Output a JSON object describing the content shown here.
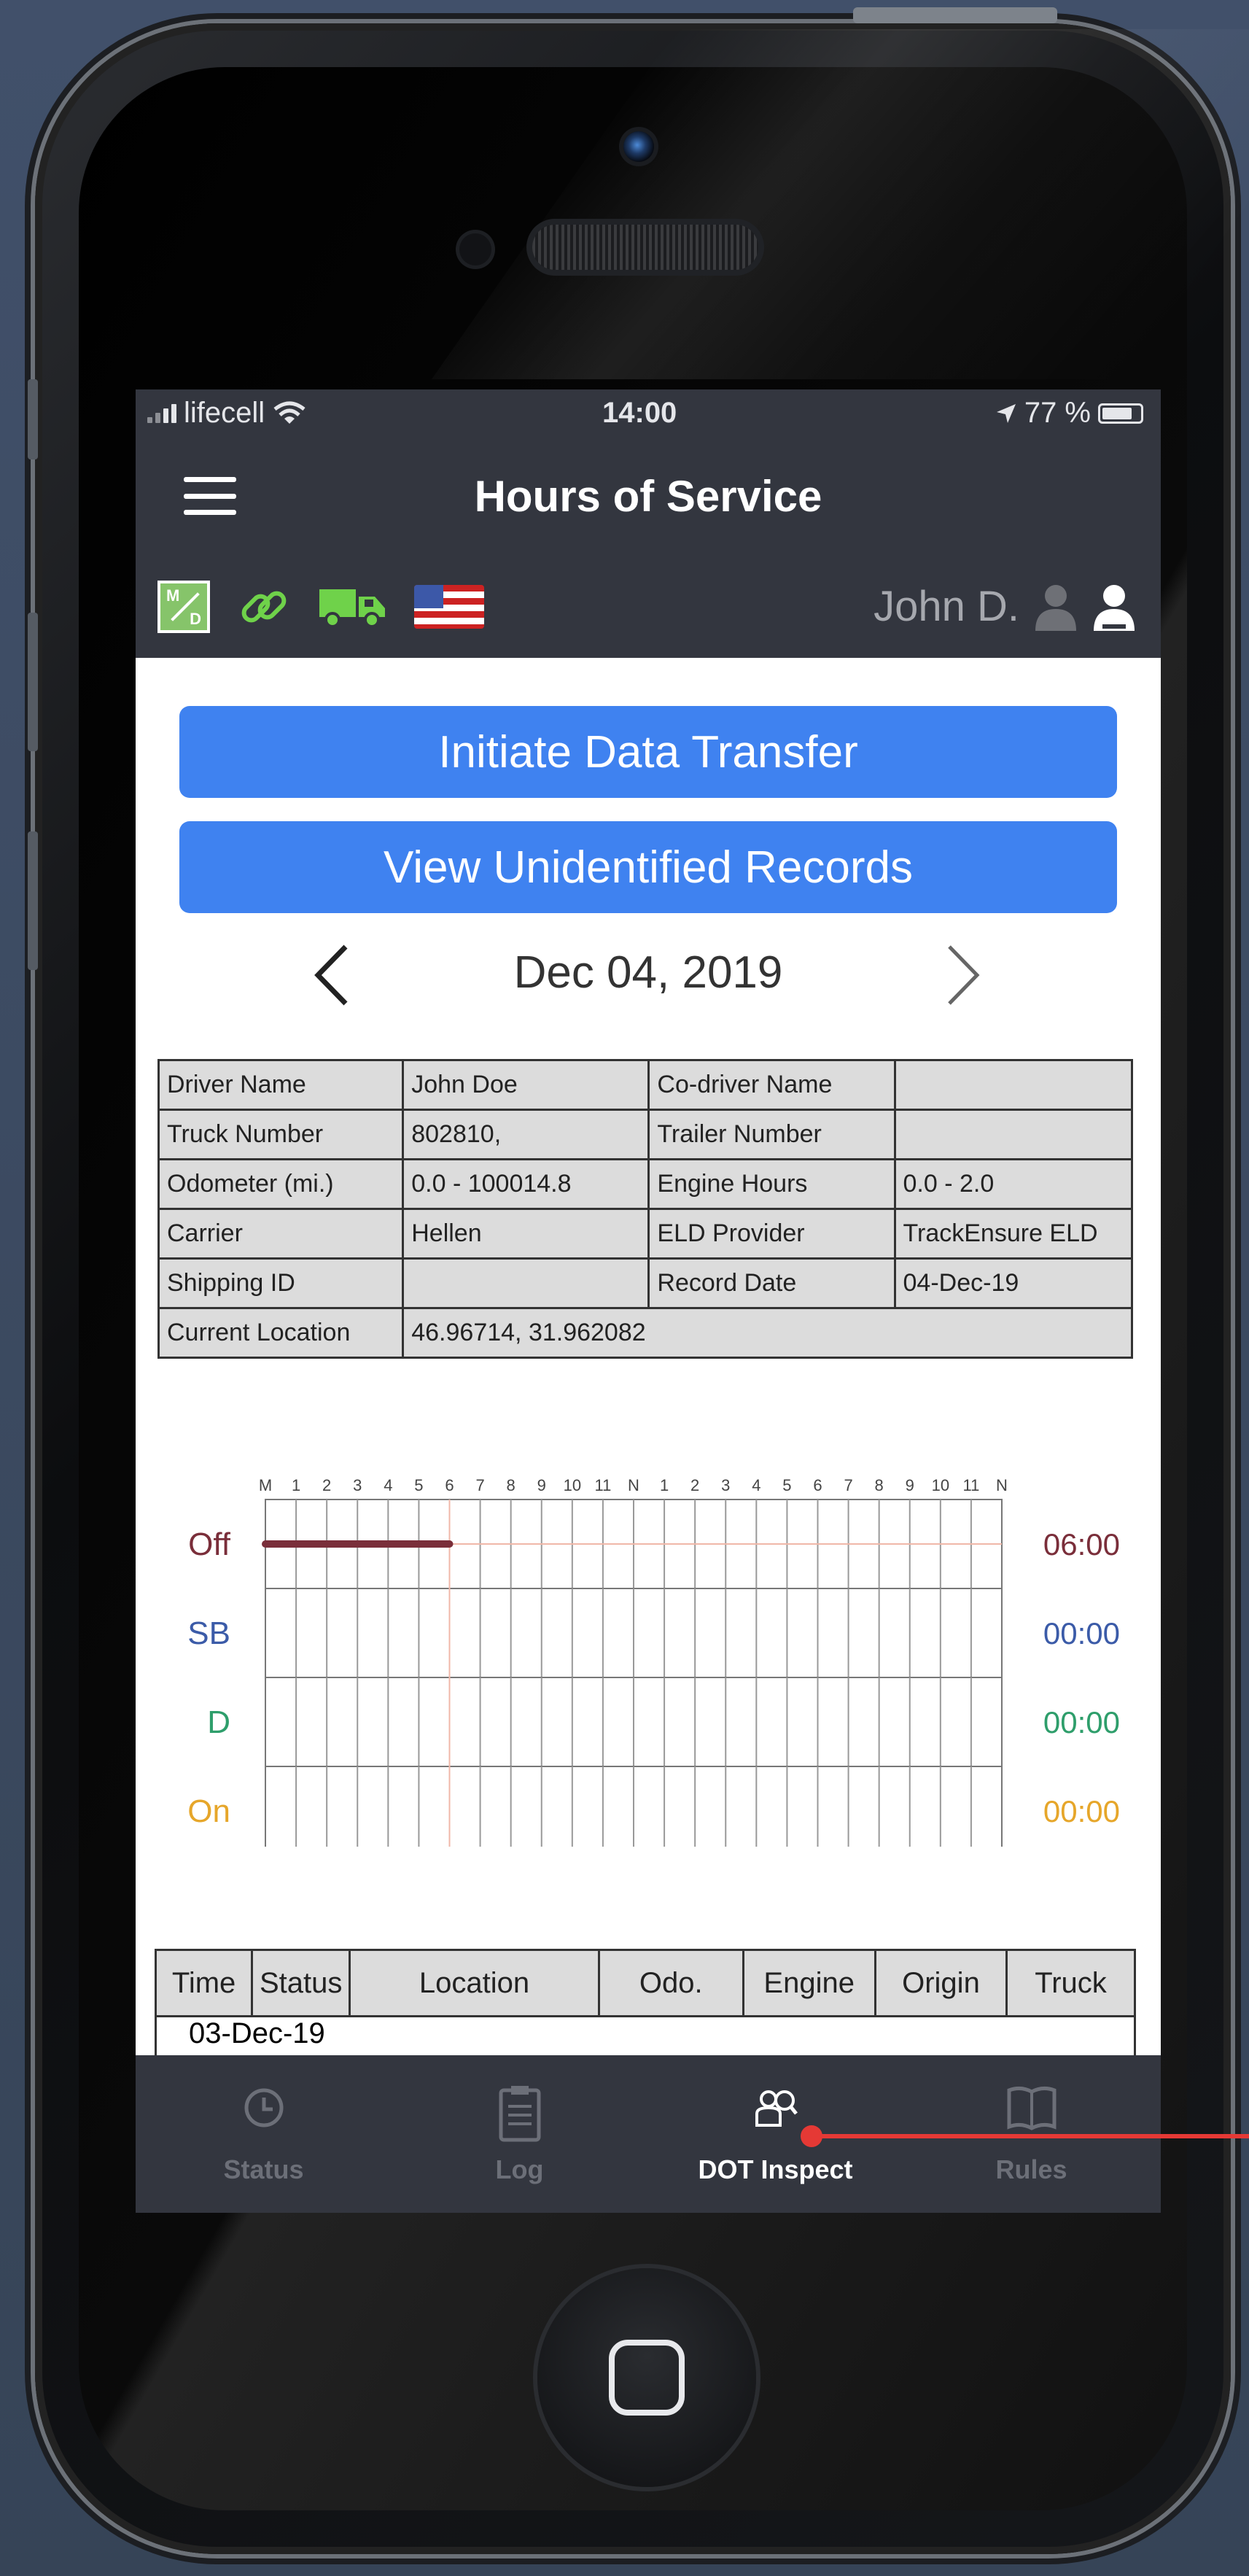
{
  "status_bar": {
    "carrier": "lifecell",
    "time": "14:00",
    "battery": "77 %"
  },
  "nav": {
    "title": "Hours of Service"
  },
  "toolbar": {
    "md_icon_top": "M",
    "md_icon_bottom": "D",
    "driver": "John D."
  },
  "actions": {
    "initiate": "Initiate Data Transfer",
    "view_unidentified": "View Unidentified Records"
  },
  "date_nav": {
    "prev": "‹",
    "date": "Dec 04, 2019",
    "next": "›"
  },
  "info_table": [
    [
      {
        "label": "Driver Name"
      },
      {
        "value": "John Doe"
      },
      {
        "label": "Co-driver Name"
      },
      {
        "value": ""
      }
    ],
    [
      {
        "label": "Truck Number"
      },
      {
        "value": "802810,"
      },
      {
        "label": "Trailer Number"
      },
      {
        "value": ""
      }
    ],
    [
      {
        "label": "Odometer (mi.)"
      },
      {
        "value": "0.0 - 100014.8"
      },
      {
        "label": "Engine Hours"
      },
      {
        "value": "0.0 - 2.0"
      }
    ],
    [
      {
        "label": "Carrier"
      },
      {
        "value": "Hellen"
      },
      {
        "label": "ELD Provider"
      },
      {
        "value": "TrackEnsure ELD"
      }
    ],
    [
      {
        "label": "Shipping ID"
      },
      {
        "value": ""
      },
      {
        "label": "Record Date"
      },
      {
        "value": "04-Dec-19"
      }
    ],
    [
      {
        "label": "Current Location"
      },
      {
        "value": "46.96714, 31.962082"
      }
    ]
  ],
  "chart_data": {
    "type": "line",
    "hours": [
      "M",
      "1",
      "2",
      "3",
      "4",
      "5",
      "6",
      "7",
      "8",
      "9",
      "10",
      "11",
      "N",
      "1",
      "2",
      "3",
      "4",
      "5",
      "6",
      "7",
      "8",
      "9",
      "10",
      "11",
      "N"
    ],
    "rows": [
      {
        "name": "Off",
        "total": "06:00",
        "color": "#7a2e3a"
      },
      {
        "name": "SB",
        "total": "00:00",
        "color": "#3b5ba8"
      },
      {
        "name": "D",
        "total": "00:00",
        "color": "#2e9e6b"
      },
      {
        "name": "On",
        "total": "00:00",
        "color": "#e6a62a"
      }
    ],
    "segments": [
      {
        "status": "Off",
        "start": 0,
        "end": 6
      }
    ],
    "xlim": [
      0,
      24
    ]
  },
  "log_table": {
    "headers": [
      "Time",
      "Status",
      "Location",
      "Odo.",
      "Engine",
      "Origin",
      "Truck"
    ],
    "first_row": "03-Dec-19"
  },
  "tabs": [
    {
      "label": "Status",
      "icon": "clock-icon"
    },
    {
      "label": "Log",
      "icon": "clipboard-icon"
    },
    {
      "label": "DOT Inspect",
      "icon": "inspect-icon",
      "active": true
    },
    {
      "label": "Rules",
      "icon": "book-icon"
    }
  ]
}
